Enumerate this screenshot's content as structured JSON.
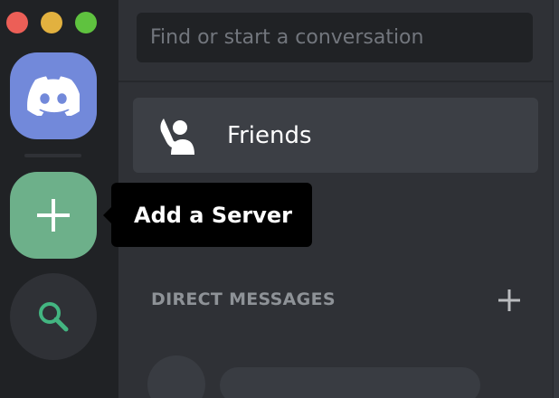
{
  "window": {
    "controls": [
      "close",
      "minimize",
      "maximize"
    ],
    "colors": {
      "close": "#ec5f57",
      "minimize": "#e2b13f",
      "maximize": "#5fc23f"
    }
  },
  "rail": {
    "home": {
      "icon": "discord-logo-icon",
      "color": "#7289da"
    },
    "add_server": {
      "icon": "plus-icon",
      "color": "#6db08a"
    },
    "explore": {
      "icon": "search-icon",
      "color": "#43b581"
    }
  },
  "tooltip": {
    "label": "Add a Server"
  },
  "search": {
    "placeholder": "Find or start a conversation"
  },
  "nav": {
    "friends": {
      "label": "Friends",
      "icon": "friends-icon"
    }
  },
  "direct_messages": {
    "title": "DIRECT MESSAGES",
    "add_icon": "plus-icon"
  }
}
